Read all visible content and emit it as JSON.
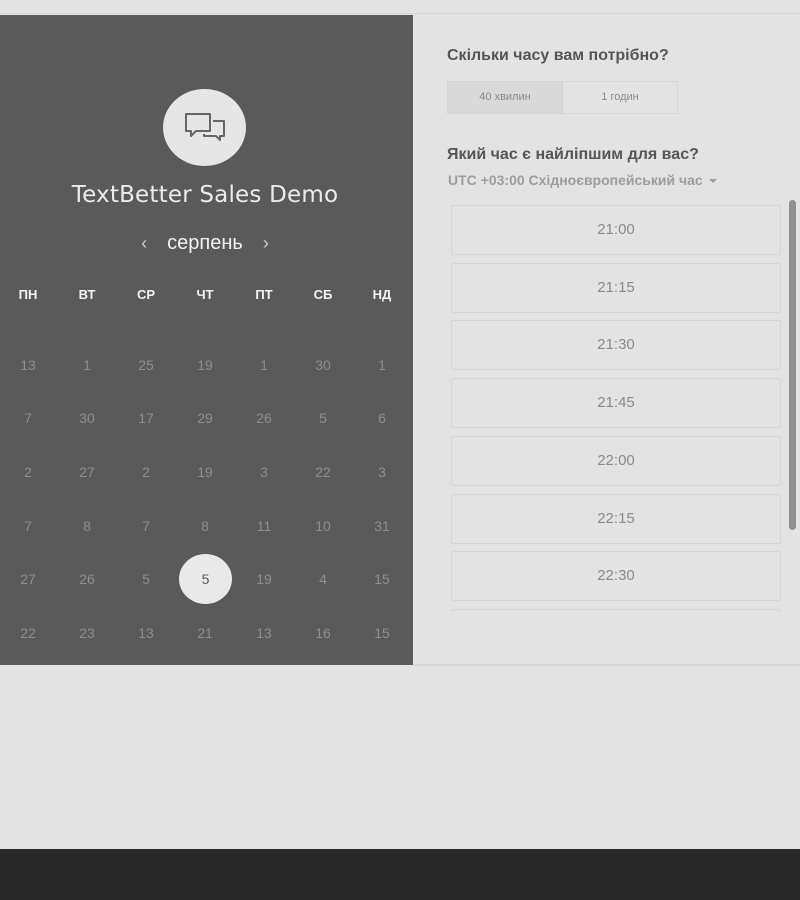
{
  "event": {
    "title": "TextBetter Sales Demo"
  },
  "calendar": {
    "month": "серпень",
    "prev": "‹",
    "next": "›",
    "weekdays": [
      "ПН",
      "ВТ",
      "СР",
      "ЧТ",
      "ПТ",
      "СБ",
      "НД"
    ],
    "weeks": [
      [
        "13",
        "1",
        "25",
        "19",
        "1",
        "30",
        "1"
      ],
      [
        "7",
        "30",
        "17",
        "29",
        "26",
        "5",
        "6"
      ],
      [
        "2",
        "27",
        "2",
        "19",
        "3",
        "22",
        "3"
      ],
      [
        "7",
        "8",
        "7",
        "8",
        "11",
        "10",
        "31"
      ],
      [
        "27",
        "26",
        "5",
        "5",
        "19",
        "4",
        "15"
      ],
      [
        "22",
        "23",
        "13",
        "21",
        "13",
        "16",
        "15"
      ]
    ],
    "selected_day": "5"
  },
  "duration": {
    "question": "Скільки часу вам потрібно?",
    "options": [
      "40 хвилин",
      "1 годин"
    ],
    "selected": "40 хвилин"
  },
  "time": {
    "question": "Який час є найліпшим для вас?",
    "timezone": "UTC +03:00 Східноєвропейський час",
    "slots": [
      "21:00",
      "21:15",
      "21:30",
      "21:45",
      "22:00",
      "22:15",
      "22:30",
      ""
    ]
  },
  "colors": {
    "left_panel": "#5a5a5a",
    "background": "#e3e3e3",
    "footer": "#272727"
  }
}
